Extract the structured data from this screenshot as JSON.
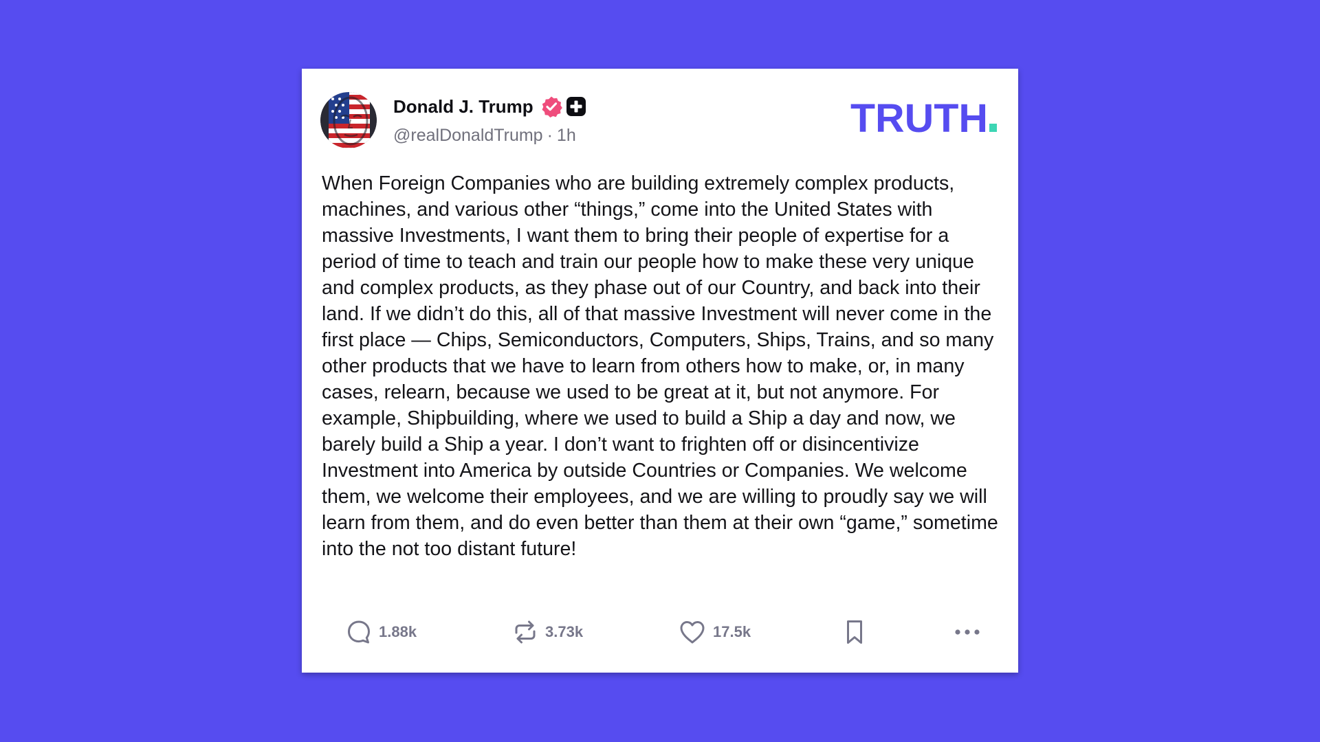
{
  "post": {
    "author": {
      "display_name": "Donald J. Trump",
      "handle": "@realDonaldTrump",
      "time": "1h",
      "separator": "·",
      "avatar_icon": "avatar-flag-portrait",
      "badges": [
        "verified-badge-icon",
        "plus-badge-icon"
      ]
    },
    "brand": {
      "logo_text": "TRUTH",
      "logo_dot": ".",
      "color": "#564cf0",
      "dot_color": "#3dd6b4"
    },
    "text": "When Foreign Companies who are building extremely complex products, machines, and various other “things,” come into the United States with massive Investments, I want them to bring their people of expertise for a period of time to teach and train our people how to make these very unique and complex products, as they phase out of our Country, and back into their land. If we didn’t do this, all of that massive Investment will never come in the first place — Chips, Semiconductors, Computers, Ships, Trains, and so many other products that we have to learn from others how to make, or, in many cases, relearn, because we used to be great at it, but not anymore. For example, Shipbuilding, where we used to build a Ship a day and now, we barely build a Ship a year. I don’t want to frighten off or disincentivize Investment into America by outside Countries or Companies. We welcome them, we welcome their employees, and we are willing to proudly say we will learn from them, and do even better than them at their own “game,” sometime into the not too distant future!",
    "actions": {
      "reply_count": "1.88k",
      "repost_count": "3.73k",
      "like_count": "17.5k",
      "icons": [
        "reply-icon",
        "repost-icon",
        "like-icon",
        "bookmark-icon",
        "more-icon"
      ]
    }
  },
  "colors": {
    "background": "#564cf0",
    "card": "#ffffff",
    "verified": "#ef4d7c",
    "muted_text": "#70707c"
  }
}
